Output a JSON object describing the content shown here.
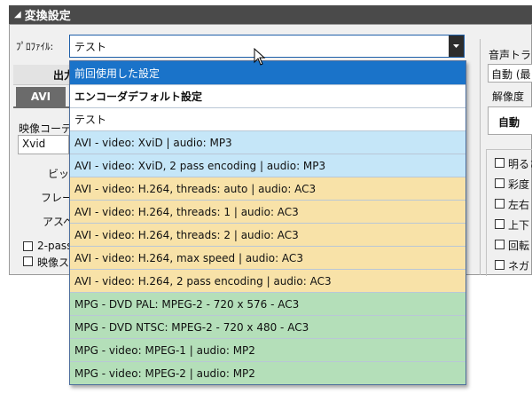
{
  "window": {
    "title": "変換設定"
  },
  "profile": {
    "label": "ﾌﾟﾛﾌｧｲﾙ:",
    "value": "テスト"
  },
  "left": {
    "output_header": "出力",
    "tab_avi": "AVI",
    "video_codec_label": "映像コーデ",
    "codec_value": "Xvid",
    "bitrate_label": "ビット",
    "frame_label": "フレー",
    "aspect_label": "アスペ",
    "two_pass_label": "2-pass",
    "video_scale_label": "映像ス"
  },
  "right": {
    "audio_track_label": "音声トラッ",
    "auto_value": "自動 (最",
    "resolution_label": "解像度",
    "res_value": "自動",
    "options": [
      "明るさ",
      "彩度",
      "左右",
      "上下",
      "回転",
      "ネガ"
    ]
  },
  "dropdown": {
    "items": [
      {
        "label": "前回使用した設定",
        "bg": "#1a73c9",
        "color": "#ffffff",
        "bold": false
      },
      {
        "label": "エンコーダデフォルト設定",
        "bg": "#ffffff",
        "color": "#111111",
        "bold": true
      },
      {
        "label": "テスト",
        "bg": "#ffffff",
        "color": "#111111",
        "bold": false
      },
      {
        "label": "AVI - video: XviD | audio: MP3",
        "bg": "#c5e6f8",
        "color": "#111111",
        "bold": false
      },
      {
        "label": "AVI - video: XviD, 2 pass encoding | audio: MP3",
        "bg": "#c5e6f8",
        "color": "#111111",
        "bold": false
      },
      {
        "label": "AVI - video: H.264, threads: auto | audio: AC3",
        "bg": "#f8e2a8",
        "color": "#111111",
        "bold": false
      },
      {
        "label": "AVI - video: H.264, threads: 1 | audio: AC3",
        "bg": "#f8e2a8",
        "color": "#111111",
        "bold": false
      },
      {
        "label": "AVI - video: H.264, threads: 2 | audio: AC3",
        "bg": "#f8e2a8",
        "color": "#111111",
        "bold": false
      },
      {
        "label": "AVI - video: H.264, max speed | audio: AC3",
        "bg": "#f8e2a8",
        "color": "#111111",
        "bold": false
      },
      {
        "label": "AVI - video: H.264, 2 pass encoding | audio: AC3",
        "bg": "#f8e2a8",
        "color": "#111111",
        "bold": false
      },
      {
        "label": "MPG - DVD PAL: MPEG-2 - 720 x 576 - AC3",
        "bg": "#b4dfb9",
        "color": "#111111",
        "bold": false
      },
      {
        "label": "MPG - DVD NTSC: MPEG-2 - 720 x 480 - AC3",
        "bg": "#b4dfb9",
        "color": "#111111",
        "bold": false
      },
      {
        "label": "MPG - video: MPEG-1 | audio: MP2",
        "bg": "#b4dfb9",
        "color": "#111111",
        "bold": false
      },
      {
        "label": "MPG - video: MPEG-2 | audio: MP2",
        "bg": "#b4dfb9",
        "color": "#111111",
        "bold": false
      }
    ]
  },
  "icons": {
    "collapse": "collapse-triangle-icon",
    "dropdown_arrow": "chevron-down-icon",
    "pointer": "mouse-pointer-icon"
  }
}
